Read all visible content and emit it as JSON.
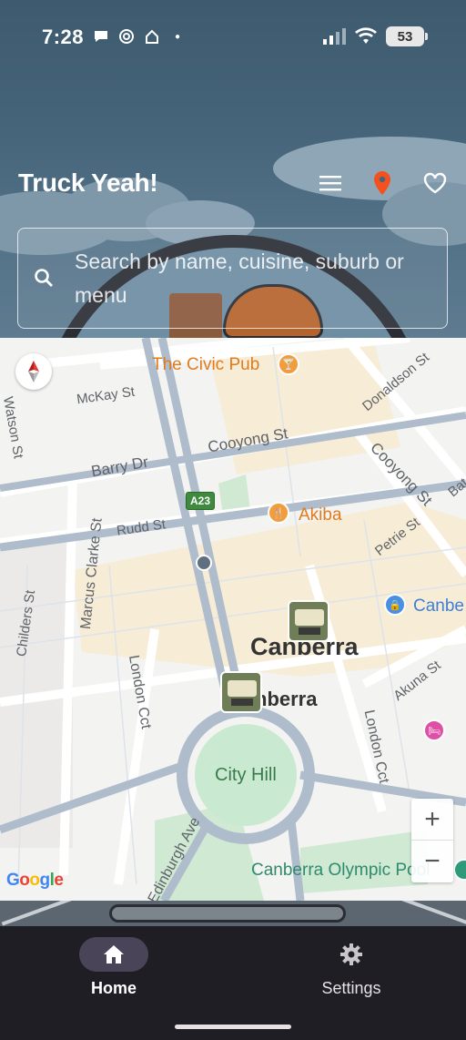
{
  "status_bar": {
    "time": "7:28",
    "battery": "53"
  },
  "app_bar": {
    "title": "Truck Yeah!",
    "menu_icon": "menu-icon",
    "location_icon": "location-pin-icon",
    "favorites_icon": "heart-icon"
  },
  "search": {
    "placeholder": "Search by name, cuisine, suburb or menu"
  },
  "map": {
    "district_label": "Canberra",
    "district_label_2": "nberra",
    "park_label": "City Hill",
    "pois": [
      {
        "name": "The Civic Pub",
        "type": "bar"
      },
      {
        "name": "Akiba",
        "type": "restaurant"
      },
      {
        "name": "Canbe",
        "type": "shopping"
      },
      {
        "name": "Canberra Olympic Pool",
        "type": "pool"
      }
    ],
    "streets": [
      "McKay St",
      "Cooyong St",
      "Barry Dr",
      "Rudd St",
      "Marcus Clarke St",
      "Childers St",
      "London Cct",
      "Edinburgh Ave",
      "Donaldson St",
      "Petrie St",
      "Akuna St",
      "Watson St",
      "Bat"
    ],
    "route_shield": "A23",
    "attribution": "Google",
    "zoom_in": "+",
    "zoom_out": "−"
  },
  "nav": {
    "items": [
      {
        "label": "Home",
        "icon": "home-icon",
        "active": true
      },
      {
        "label": "Settings",
        "icon": "gear-icon",
        "active": false
      }
    ]
  },
  "colors": {
    "accent": "#f4511e",
    "nav_bg": "#1f1e24",
    "active_pill": "#4a4458",
    "header_bg": "#46657a"
  }
}
